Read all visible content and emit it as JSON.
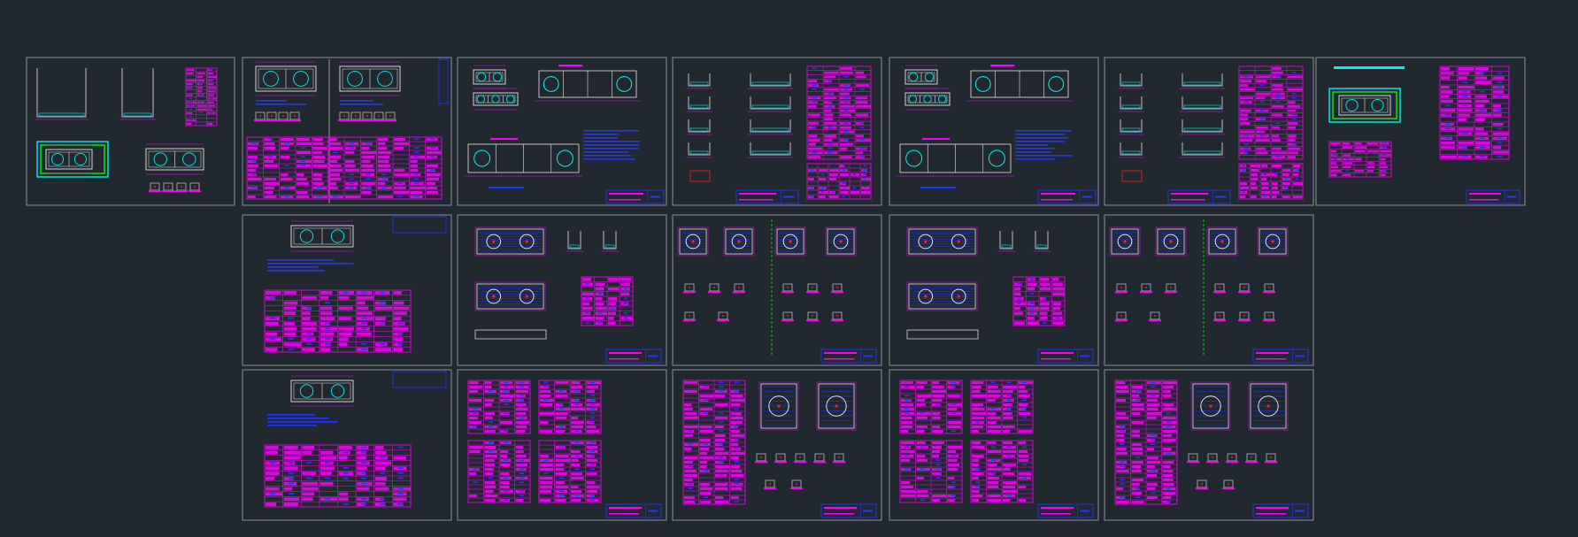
{
  "app": {
    "view": "cad-model-space",
    "background": "#212830"
  },
  "colors": {
    "sheet_border": "#8c9299",
    "title_block": "#1f37ff",
    "table": "#ff00ff",
    "table_text": "#1f37ff",
    "drawing_white": "#e8e8e8",
    "drawing_cyan": "#00f0f0",
    "drawing_green": "#00e000",
    "drawing_red": "#ff2020",
    "drawing_yellow": "#f0f000"
  },
  "sheets": [
    {
      "id": "sheet-r1-c1",
      "content": "plan-section-with-table"
    },
    {
      "id": "sheet-r1-c2",
      "content": "plans-with-large-table"
    },
    {
      "id": "sheet-r1-c3",
      "content": "elevations-with-notes"
    },
    {
      "id": "sheet-r1-c4",
      "content": "details-with-table"
    },
    {
      "id": "sheet-r1-c5",
      "content": "elevations-with-notes"
    },
    {
      "id": "sheet-r1-c6",
      "content": "details-with-table"
    },
    {
      "id": "sheet-r1-c7",
      "content": "plan-with-table"
    },
    {
      "id": "sheet-r2-c2",
      "content": "plan-with-large-table"
    },
    {
      "id": "sheet-r2-c3",
      "content": "reinforcement-plan-sections"
    },
    {
      "id": "sheet-r2-c4",
      "content": "reinforcement-details"
    },
    {
      "id": "sheet-r2-c5",
      "content": "reinforcement-plan-sections"
    },
    {
      "id": "sheet-r2-c6",
      "content": "reinforcement-details"
    },
    {
      "id": "sheet-r3-c2",
      "content": "plan-with-large-table"
    },
    {
      "id": "sheet-r3-c3",
      "content": "rebar-schedule-tables"
    },
    {
      "id": "sheet-r3-c4",
      "content": "tables-with-details"
    },
    {
      "id": "sheet-r3-c5",
      "content": "rebar-schedule-tables"
    },
    {
      "id": "sheet-r3-c6",
      "content": "tables-with-details"
    }
  ]
}
